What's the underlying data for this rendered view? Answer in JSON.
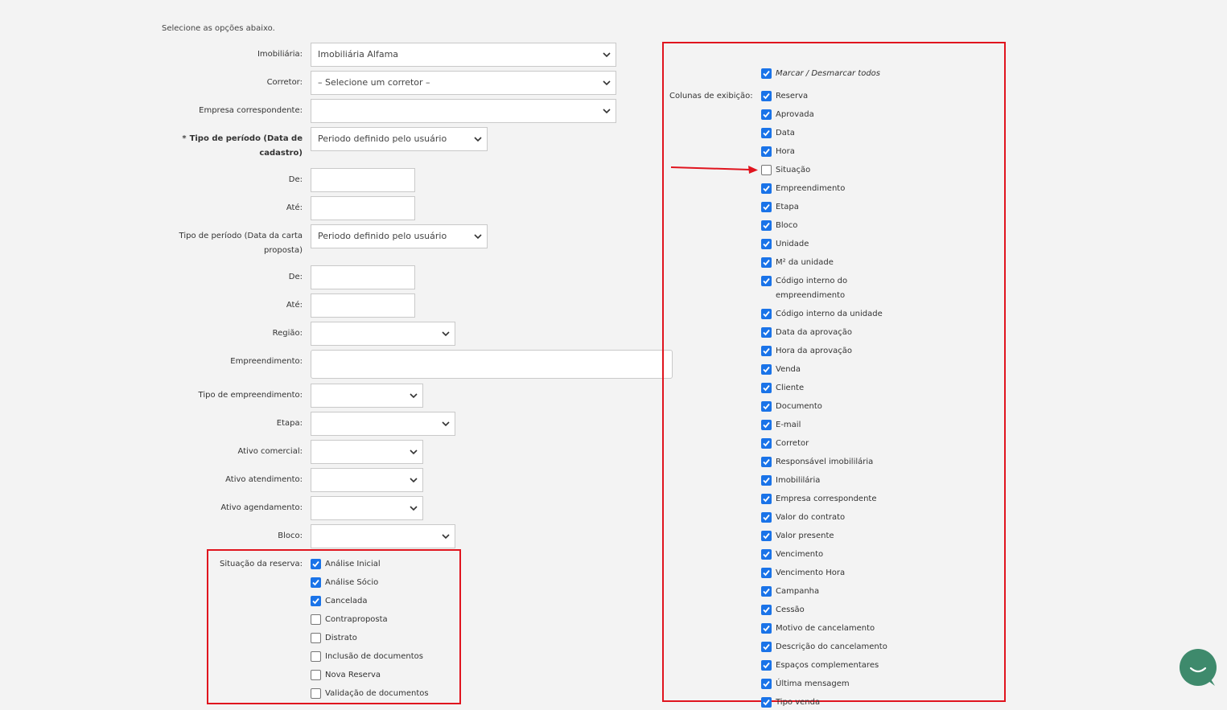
{
  "intro": "Selecione as opções abaixo.",
  "fields": {
    "imobiliaria": {
      "label": "Imobiliária:",
      "value": "Imobiliária Alfama"
    },
    "corretor": {
      "label": "Corretor:",
      "value": "– Selecione um corretor –"
    },
    "empresa": {
      "label": "Empresa correspondente:",
      "value": ""
    },
    "tipo_periodo_cadastro": {
      "label_line1": "Tipo de período (Data de",
      "label_line2": "cadastro)",
      "required_mark": "*",
      "value": "Periodo definido pelo usuário"
    },
    "de1": {
      "label": "De:",
      "value": ""
    },
    "ate1": {
      "label": "Até:",
      "value": ""
    },
    "tipo_periodo_carta": {
      "label_line1": "Tipo de período (Data da carta",
      "label_line2": "proposta)",
      "value": "Periodo definido pelo usuário"
    },
    "de2": {
      "label": "De:",
      "value": ""
    },
    "ate2": {
      "label": "Até:",
      "value": ""
    },
    "regiao": {
      "label": "Região:",
      "value": ""
    },
    "empreendimento": {
      "label": "Empreendimento:",
      "value": ""
    },
    "tipo_empreendimento": {
      "label": "Tipo de empreendimento:",
      "value": ""
    },
    "etapa": {
      "label": "Etapa:",
      "value": ""
    },
    "ativo_comercial": {
      "label": "Ativo comercial:",
      "value": ""
    },
    "ativo_atendimento": {
      "label": "Ativo atendimento:",
      "value": ""
    },
    "ativo_agendamento": {
      "label": "Ativo agendamento:",
      "value": ""
    },
    "bloco": {
      "label": "Bloco:",
      "value": ""
    }
  },
  "situacao": {
    "label": "Situação da reserva:",
    "options": [
      {
        "label": "Análise Inicial",
        "checked": true
      },
      {
        "label": "Análise Sócio",
        "checked": true
      },
      {
        "label": "Cancelada",
        "checked": true
      },
      {
        "label": "Contraproposta",
        "checked": false
      },
      {
        "label": "Distrato",
        "checked": false
      },
      {
        "label": "Inclusão de documentos",
        "checked": false
      },
      {
        "label": "Nova Reserva",
        "checked": false
      },
      {
        "label": "Validação de documentos",
        "checked": false
      }
    ]
  },
  "colunas": {
    "toggle_all": "Marcar / Desmarcar todos",
    "label": "Colunas de exibição:",
    "options": [
      {
        "label": "Reserva",
        "checked": true
      },
      {
        "label": "Aprovada",
        "checked": true
      },
      {
        "label": "Data",
        "checked": true
      },
      {
        "label": "Hora",
        "checked": true
      },
      {
        "label": "Situação",
        "checked": false
      },
      {
        "label": "Empreendimento",
        "checked": true
      },
      {
        "label": "Etapa",
        "checked": true
      },
      {
        "label": "Bloco",
        "checked": true
      },
      {
        "label": "Unidade",
        "checked": true
      },
      {
        "label": "M² da unidade",
        "checked": true
      },
      {
        "label": "Código interno do",
        "label2": "empreendimento",
        "checked": true
      },
      {
        "label": "Código interno da unidade",
        "checked": true
      },
      {
        "label": "Data da aprovação",
        "checked": true
      },
      {
        "label": "Hora da aprovação",
        "checked": true
      },
      {
        "label": "Venda",
        "checked": true
      },
      {
        "label": "Cliente",
        "checked": true
      },
      {
        "label": "Documento",
        "checked": true
      },
      {
        "label": "E-mail",
        "checked": true
      },
      {
        "label": "Corretor",
        "checked": true
      },
      {
        "label": "Responsável imobililária",
        "checked": true
      },
      {
        "label": "Imobililária",
        "checked": true
      },
      {
        "label": "Empresa correspondente",
        "checked": true
      },
      {
        "label": "Valor do contrato",
        "checked": true
      },
      {
        "label": "Valor presente",
        "checked": true
      },
      {
        "label": "Vencimento",
        "checked": true
      },
      {
        "label": "Vencimento Hora",
        "checked": true
      },
      {
        "label": "Campanha",
        "checked": true
      },
      {
        "label": "Cessão",
        "checked": true
      },
      {
        "label": "Motivo de cancelamento",
        "checked": true
      },
      {
        "label": "Descrição do cancelamento",
        "checked": true
      },
      {
        "label": "Espaços complementares",
        "checked": true
      },
      {
        "label": "Última mensagem",
        "checked": true
      },
      {
        "label": "Tipo venda",
        "checked": true
      }
    ]
  },
  "colors": {
    "accent": "#1a73e8",
    "highlight": "#e0141e",
    "chat": "#3e8a6c"
  }
}
